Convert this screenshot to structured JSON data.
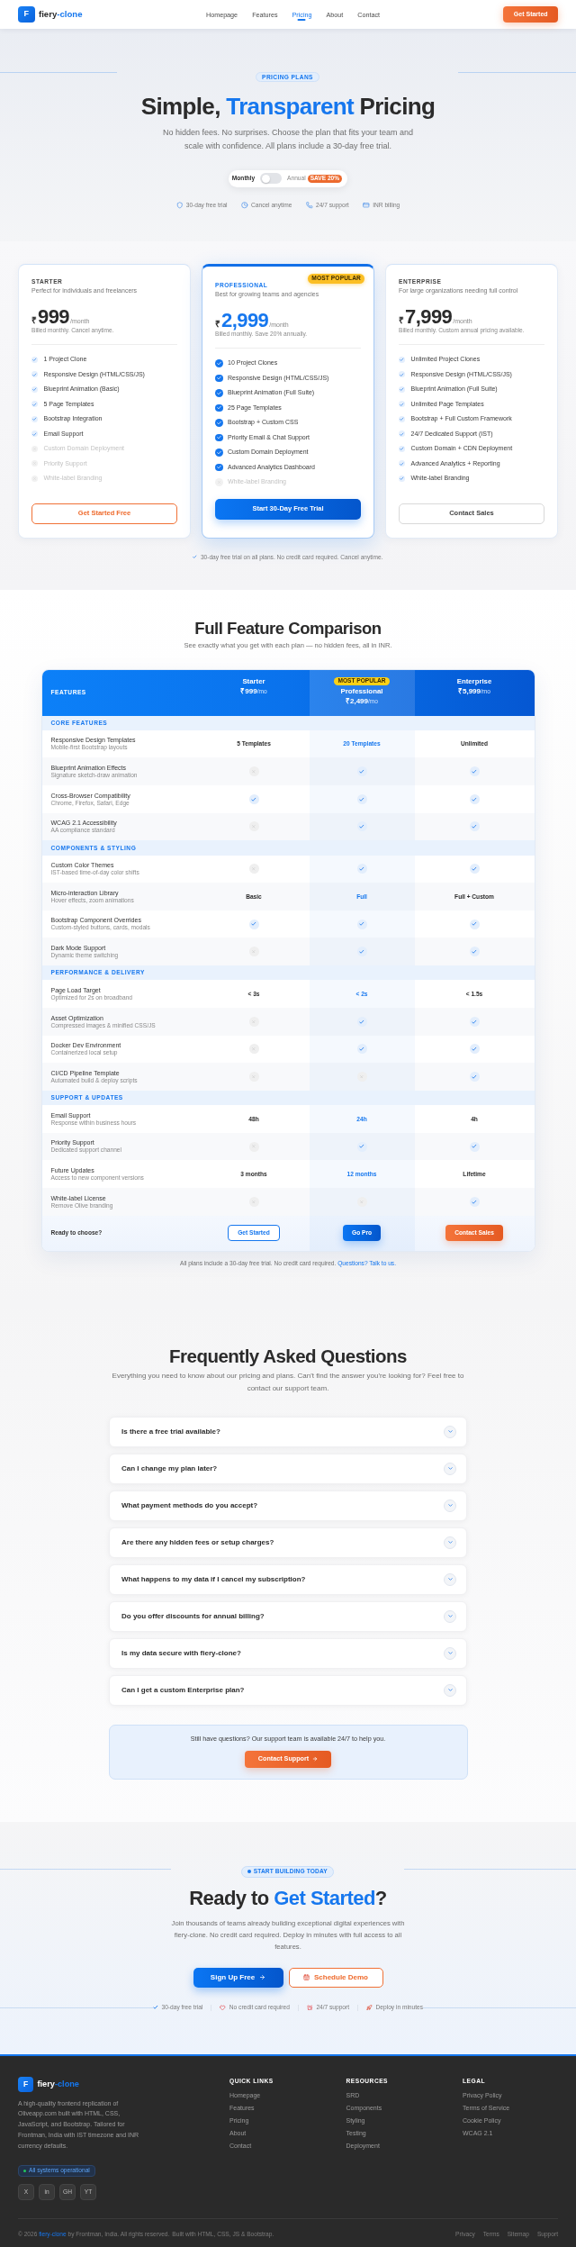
{
  "header": {
    "logo_letter": "F",
    "brand": "fiery",
    "brand_accent": "-clone",
    "nav": [
      {
        "label": "Homepage",
        "selected": false
      },
      {
        "label": "Features",
        "selected": false
      },
      {
        "label": "Pricing",
        "selected": true
      },
      {
        "label": "About",
        "selected": false
      },
      {
        "label": "Contact",
        "selected": false
      }
    ],
    "cta": "Get Started"
  },
  "hero": {
    "eyebrow": "PRICING PLANS",
    "title": [
      {
        "text": "Simple, ",
        "highlight": false
      },
      {
        "text": "Transparent",
        "highlight": true
      },
      {
        "text": " Pricing",
        "highlight": false
      }
    ],
    "subtitle": "No hidden fees. No surprises. Choose the plan that fits your team and scale with confidence. All plans include a 30-day free trial.",
    "billing_toggle": {
      "monthly_label": "Monthly",
      "annual_label": "Annual",
      "discount": "SAVE 20%",
      "annual_selected": false
    },
    "perks": [
      "30-day free trial",
      "Cancel anytime",
      "24/7 support",
      "INR billing"
    ]
  },
  "plans": [
    {
      "tier": "STARTER",
      "description": "Perfect for individuals and freelancers",
      "currency": "₹",
      "price": "999",
      "period": "/month",
      "billing_note": "Billed monthly. Cancel anytime.",
      "featured": false,
      "features": [
        {
          "text": "1 Project Clone",
          "included": true
        },
        {
          "text": "Responsive Design (HTML/CSS/JS)",
          "included": true
        },
        {
          "text": "Blueprint Animation (Basic)",
          "included": true
        },
        {
          "text": "5 Page Templates",
          "included": true
        },
        {
          "text": "Bootstrap Integration",
          "included": true
        },
        {
          "text": "Email Support",
          "included": true
        },
        {
          "text": "Custom Domain Deployment",
          "included": false
        },
        {
          "text": "Priority Support",
          "included": false
        },
        {
          "text": "White-label Branding",
          "included": false
        }
      ],
      "button": {
        "label": "Get Started Free",
        "kind": "accent_outline"
      }
    },
    {
      "tier": "PROFESSIONAL",
      "description": "Best for growing teams and agencies",
      "currency": "₹",
      "price": "2,999",
      "period": "/month",
      "billing_note": "Billed monthly. Save 20% annually.",
      "featured": true,
      "badge": "MOST POPULAR",
      "features": [
        {
          "text": "10 Project Clones",
          "included": true
        },
        {
          "text": "Responsive Design (HTML/CSS/JS)",
          "included": true
        },
        {
          "text": "Blueprint Animation (Full Suite)",
          "included": true
        },
        {
          "text": "25 Page Templates",
          "included": true
        },
        {
          "text": "Bootstrap + Custom CSS",
          "included": true
        },
        {
          "text": "Priority Email & Chat Support",
          "included": true
        },
        {
          "text": "Custom Domain Deployment",
          "included": true
        },
        {
          "text": "Advanced Analytics Dashboard",
          "included": true
        },
        {
          "text": "White-label Branding",
          "included": false
        }
      ],
      "button": {
        "label": "Start 30-Day Free Trial",
        "kind": "primary"
      }
    },
    {
      "tier": "ENTERPRISE",
      "description": "For large organizations needing full control",
      "currency": "₹",
      "price": "7,999",
      "period": "/month",
      "billing_note": "Billed monthly. Custom annual pricing available.",
      "featured": false,
      "features": [
        {
          "text": "Unlimited Project Clones",
          "included": true
        },
        {
          "text": "Responsive Design (HTML/CSS/JS)",
          "included": true
        },
        {
          "text": "Blueprint Animation (Full Suite)",
          "included": true
        },
        {
          "text": "Unlimited Page Templates",
          "included": true
        },
        {
          "text": "Bootstrap + Full Custom Framework",
          "included": true
        },
        {
          "text": "24/7 Dedicated Support (IST)",
          "included": true
        },
        {
          "text": "Custom Domain + CDN Deployment",
          "included": true
        },
        {
          "text": "Advanced Analytics + Reporting",
          "included": true
        },
        {
          "text": "White-label Branding",
          "included": true
        }
      ],
      "button": {
        "label": "Contact Sales",
        "kind": "neutral"
      }
    }
  ],
  "plans_note": "30-day free trial on all plans. No credit card required. Cancel anytime.",
  "comparison": {
    "title": "Full Feature Comparison",
    "subtitle": "See exactly what you get with each plan — no hidden fees, all in INR.",
    "features_label": "FEATURES",
    "plans": [
      {
        "name": "Starter",
        "price": "₹999",
        "period": "/mo",
        "featured": false,
        "button": {
          "label": "Get Started",
          "kind": "outline"
        }
      },
      {
        "name": "Professional",
        "price": "₹2,499",
        "period": "/mo",
        "featured": true,
        "badge": "MOST POPULAR",
        "button": {
          "label": "Go Pro",
          "kind": "primary"
        }
      },
      {
        "name": "Enterprise",
        "price": "₹5,999",
        "period": "/mo",
        "featured": false,
        "button": {
          "label": "Contact Sales",
          "kind": "accent"
        }
      }
    ],
    "groups": [
      {
        "name": "CORE FEATURES",
        "rows": [
          {
            "name": "Responsive Design Templates",
            "detail": "Mobile-first Bootstrap layouts",
            "cells": [
              {
                "kind": "text",
                "text": "5 Templates"
              },
              {
                "kind": "text",
                "text": "20 Templates"
              },
              {
                "kind": "text",
                "text": "Unlimited"
              }
            ]
          },
          {
            "name": "Blueprint Animation Effects",
            "detail": "Signature sketch-draw animation",
            "cells": [
              {
                "kind": "mark",
                "included": false
              },
              {
                "kind": "mark",
                "included": true
              },
              {
                "kind": "mark",
                "included": true
              }
            ]
          },
          {
            "name": "Cross-Browser Compatibility",
            "detail": "Chrome, Firefox, Safari, Edge",
            "cells": [
              {
                "kind": "mark",
                "included": true
              },
              {
                "kind": "mark",
                "included": true
              },
              {
                "kind": "mark",
                "included": true
              }
            ]
          },
          {
            "name": "WCAG 2.1 Accessibility",
            "detail": "AA compliance standard",
            "cells": [
              {
                "kind": "mark",
                "included": false
              },
              {
                "kind": "mark",
                "included": true
              },
              {
                "kind": "mark",
                "included": true
              }
            ]
          }
        ]
      },
      {
        "name": "COMPONENTS & STYLING",
        "rows": [
          {
            "name": "Custom Color Themes",
            "detail": "IST-based time-of-day color shifts",
            "cells": [
              {
                "kind": "mark",
                "included": false
              },
              {
                "kind": "mark",
                "included": true
              },
              {
                "kind": "mark",
                "included": true
              }
            ]
          },
          {
            "name": "Micro-interaction Library",
            "detail": "Hover effects, zoom animations",
            "cells": [
              {
                "kind": "text",
                "text": "Basic"
              },
              {
                "kind": "text",
                "text": "Full"
              },
              {
                "kind": "text",
                "text": "Full + Custom"
              }
            ]
          },
          {
            "name": "Bootstrap Component Overrides",
            "detail": "Custom-styled buttons, cards, modals",
            "cells": [
              {
                "kind": "mark",
                "included": true
              },
              {
                "kind": "mark",
                "included": true
              },
              {
                "kind": "mark",
                "included": true
              }
            ]
          },
          {
            "name": "Dark Mode Support",
            "detail": "Dynamic theme switching",
            "cells": [
              {
                "kind": "mark",
                "included": false
              },
              {
                "kind": "mark",
                "included": true
              },
              {
                "kind": "mark",
                "included": true
              }
            ]
          }
        ]
      },
      {
        "name": "PERFORMANCE & DELIVERY",
        "rows": [
          {
            "name": "Page Load Target",
            "detail": "Optimized for 2s on broadband",
            "cells": [
              {
                "kind": "text",
                "text": "< 3s"
              },
              {
                "kind": "text",
                "text": "< 2s"
              },
              {
                "kind": "text",
                "text": "< 1.5s"
              }
            ]
          },
          {
            "name": "Asset Optimization",
            "detail": "Compressed images & minified CSS/JS",
            "cells": [
              {
                "kind": "mark",
                "included": false
              },
              {
                "kind": "mark",
                "included": true
              },
              {
                "kind": "mark",
                "included": true
              }
            ]
          },
          {
            "name": "Docker Dev Environment",
            "detail": "Containerized local setup",
            "cells": [
              {
                "kind": "mark",
                "included": false
              },
              {
                "kind": "mark",
                "included": true
              },
              {
                "kind": "mark",
                "included": true
              }
            ]
          },
          {
            "name": "CI/CD Pipeline Template",
            "detail": "Automated build & deploy scripts",
            "cells": [
              {
                "kind": "mark",
                "included": false
              },
              {
                "kind": "mark",
                "included": false
              },
              {
                "kind": "mark",
                "included": true
              }
            ]
          }
        ]
      },
      {
        "name": "SUPPORT & UPDATES",
        "rows": [
          {
            "name": "Email Support",
            "detail": "Response within business hours",
            "cells": [
              {
                "kind": "text",
                "text": "48h"
              },
              {
                "kind": "text",
                "text": "24h"
              },
              {
                "kind": "text",
                "text": "4h"
              }
            ]
          },
          {
            "name": "Priority Support",
            "detail": "Dedicated support channel",
            "cells": [
              {
                "kind": "mark",
                "included": false
              },
              {
                "kind": "mark",
                "included": true
              },
              {
                "kind": "mark",
                "included": true
              }
            ]
          },
          {
            "name": "Future Updates",
            "detail": "Access to new component versions",
            "cells": [
              {
                "kind": "text",
                "text": "3 months"
              },
              {
                "kind": "text",
                "text": "12 months"
              },
              {
                "kind": "text",
                "text": "Lifetime"
              }
            ]
          },
          {
            "name": "White-label License",
            "detail": "Remove Olive branding",
            "cells": [
              {
                "kind": "mark",
                "included": false
              },
              {
                "kind": "mark",
                "included": false
              },
              {
                "kind": "mark",
                "included": true
              }
            ]
          }
        ]
      }
    ],
    "footer_label": "Ready to choose?",
    "note": "All plans include a 30-day free trial. No credit card required.",
    "note_link": "Questions? Talk to us."
  },
  "faq": {
    "title": "Frequently Asked Questions",
    "subtitle": "Everything you need to know about our pricing and plans. Can't find the answer you're looking for? Feel free to contact our support team.",
    "items": [
      {
        "question": "Is there a free trial available?",
        "expanded": false
      },
      {
        "question": "Can I change my plan later?",
        "expanded": false
      },
      {
        "question": "What payment methods do you accept?",
        "expanded": false
      },
      {
        "question": "Are there any hidden fees or setup charges?",
        "expanded": false
      },
      {
        "question": "What happens to my data if I cancel my subscription?",
        "expanded": false
      },
      {
        "question": "Do you offer discounts for annual billing?",
        "expanded": false
      },
      {
        "question": "Is my data secure with fiery-clone?",
        "expanded": false
      },
      {
        "question": "Can I get a custom Enterprise plan?",
        "expanded": false
      }
    ],
    "support_text": "Still have questions? Our support team is available 24/7 to help you.",
    "support_button": "Contact Support"
  },
  "cta": {
    "eyebrow": "START BUILDING TODAY",
    "title": [
      {
        "text": "Ready to ",
        "highlight": false
      },
      {
        "text": "Get Started",
        "highlight": true
      },
      {
        "text": "?",
        "highlight": false
      }
    ],
    "text": "Join thousands of teams already building exceptional digital experiences with fiery-clone. No credit card required. Deploy in minutes with full access to all features.",
    "primary_button": "Sign Up Free",
    "secondary_button": "Schedule Demo",
    "trust": [
      "30-day free trial",
      "No credit card required",
      "24/7 support",
      "Deploy in minutes"
    ]
  },
  "footer": {
    "logo_letter": "F",
    "brand": "fiery",
    "brand_accent": "-clone",
    "description": "A high-quality frontend replication of Oliveapp.com built with HTML, CSS, JavaScript, and Bootstrap. Tailored for Frontman, India with IST timezone and INR currency defaults.",
    "status": "All systems operational",
    "socials": [
      "X",
      "in",
      "GH",
      "YT"
    ],
    "columns": [
      {
        "title": "QUICK LINKS",
        "links": [
          "Homepage",
          "Features",
          "Pricing",
          "About",
          "Contact"
        ]
      },
      {
        "title": "RESOURCES",
        "links": [
          "SRD",
          "Components",
          "Styling",
          "Testing",
          "Deployment"
        ]
      },
      {
        "title": "LEGAL",
        "links": [
          "Privacy Policy",
          "Terms of Service",
          "Cookie Policy",
          "WCAG 2.1"
        ]
      }
    ],
    "copyright_before": "© 2026",
    "copyright_link": "fiery-clone",
    "copyright_after": "by Frontman, India. All rights reserved.",
    "built_with": "Built with HTML, CSS, JS & Bootstrap.",
    "bottom_links": [
      "Privacy",
      "Terms",
      "Sitemap",
      "Support"
    ]
  }
}
